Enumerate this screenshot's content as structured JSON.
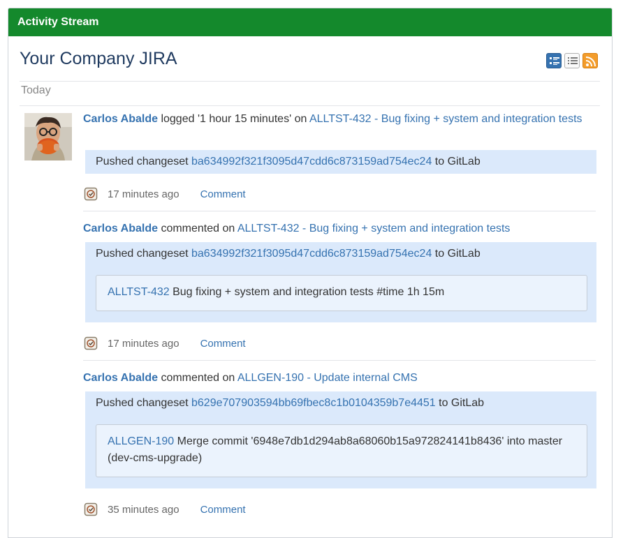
{
  "header": {
    "title": "Activity Stream"
  },
  "stream": {
    "title": "Your Company JIRA",
    "view_icons": [
      "full-view-icon",
      "list-view-icon",
      "rss-feed-icon"
    ],
    "day_label": "Today"
  },
  "entries": [
    {
      "user": "Carlos Abalde",
      "action_pre": " logged '1 hour 15 minutes' on ",
      "issue_link": "ALLTST-432 - Bug fixing + system and integration tests",
      "changeset": {
        "prefix": "Pushed changeset ",
        "hash": "ba634992f321f3095d47cdd6c873159ad754ec24",
        "suffix": " to GitLab"
      },
      "time": "17 minutes ago",
      "comment_label": "Comment"
    },
    {
      "user": "Carlos Abalde",
      "action_pre": " commented on ",
      "issue_link": "ALLTST-432 - Bug fixing + system and integration tests",
      "changeset": {
        "prefix": "Pushed changeset ",
        "hash": "ba634992f321f3095d47cdd6c873159ad754ec24",
        "suffix": " to GitLab"
      },
      "commit": {
        "key": "ALLTST-432",
        "message": " Bug fixing + system and integration tests #time 1h 15m"
      },
      "time": "17 minutes ago",
      "comment_label": "Comment"
    },
    {
      "user": "Carlos Abalde",
      "action_pre": " commented on ",
      "issue_link": "ALLGEN-190 - Update internal CMS",
      "changeset": {
        "prefix": "Pushed changeset ",
        "hash": "b629e707903594bb69fbec8c1b0104359b7e4451",
        "suffix": " to GitLab"
      },
      "commit": {
        "key": "ALLGEN-190",
        "message": " Merge commit '6948e7db1d294ab8a68060b15a972824141b8436' into master (dev-cms-upgrade)"
      },
      "time": "35 minutes ago",
      "comment_label": "Comment"
    }
  ],
  "colors": {
    "header_green": "#14892c",
    "link_blue": "#3572b0",
    "box_blue": "#dbe9fb"
  }
}
